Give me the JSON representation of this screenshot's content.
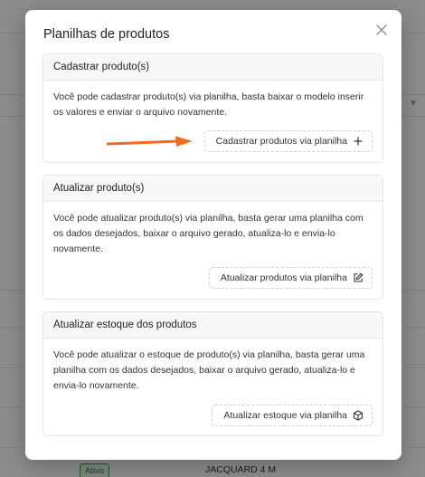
{
  "background": {
    "row_badge": "Ativo",
    "row_product": "JACQUARD 4 M"
  },
  "modal": {
    "title": "Planilhas de produtos",
    "close_icon": "close-icon"
  },
  "cards": [
    {
      "title": "Cadastrar produto(s)",
      "description": "Você pode cadastrar produto(s) via planilha, basta baixar o modelo inserir os valores e enviar o arquivo novamente.",
      "button_label": "Cadastrar produtos via planilha",
      "button_icon": "plus-icon"
    },
    {
      "title": "Atualizar produto(s)",
      "description": "Você pode atualizar produto(s) via planilha, basta gerar uma planilha com os dados desejados, baixar o arquivo gerado, atualiza-lo e envia-lo novamente.",
      "button_label": "Atualizar produtos via planilha",
      "button_icon": "edit-icon"
    },
    {
      "title": "Atualizar estoque dos produtos",
      "description": "Você pode atualizar o estoque de produto(s) via planilha, basta gerar uma planilha com os dados desejados, baixar o arquivo gerado, atualiza-lo e envia-lo novamente.",
      "button_label": "Atualizar estoque via planilha",
      "button_icon": "box-icon"
    }
  ],
  "annotation": {
    "arrow_color": "#f26a1b"
  },
  "colors": {
    "overlay": "rgba(0,0,0,0.45)",
    "badge_border": "#46a05a"
  }
}
